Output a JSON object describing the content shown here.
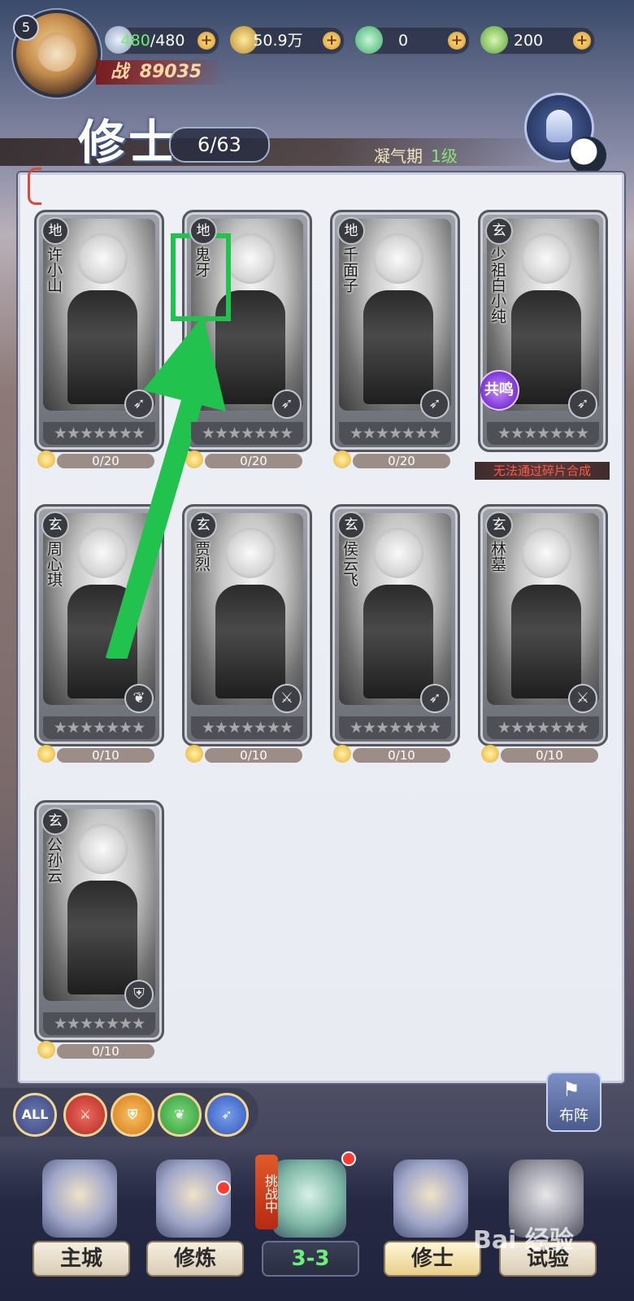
{
  "player": {
    "level": "5",
    "power_label": "战",
    "power_value": "89035"
  },
  "resources": {
    "stamina_current": "480",
    "stamina_sep_max": "/480",
    "coins": "50.9万",
    "jade": "0",
    "leaf": "200"
  },
  "page": {
    "title": "修士",
    "count": "6/63",
    "realm": "凝气期",
    "realm_level": "1级"
  },
  "cards": [
    {
      "grade": "地",
      "name": "许小山",
      "class_icon": "arrow-icon",
      "shards": "0/20"
    },
    {
      "grade": "地",
      "name": "鬼牙",
      "class_icon": "arrow-icon",
      "shards": "0/20"
    },
    {
      "grade": "地",
      "name": "千面子",
      "class_icon": "arrow-icon",
      "shards": "0/20"
    },
    {
      "grade": "玄",
      "name": "少祖白小纯",
      "class_icon": "arrow-icon",
      "resonance": "共鸣",
      "notice": "无法通过碎片合成"
    },
    {
      "grade": "玄",
      "name": "周心琪",
      "class_icon": "leaf-icon",
      "shards": "0/10"
    },
    {
      "grade": "玄",
      "name": "贾烈",
      "class_icon": "sword-icon",
      "shards": "0/10"
    },
    {
      "grade": "玄",
      "name": "侯云飞",
      "class_icon": "arrow-icon",
      "shards": "0/10"
    },
    {
      "grade": "玄",
      "name": "林墓",
      "class_icon": "sword-icon",
      "shards": "0/10"
    },
    {
      "grade": "玄",
      "name": "公孙云",
      "class_icon": "shield-icon",
      "shards": "0/10"
    }
  ],
  "stars_glyph": "★★★★★★★",
  "filters": {
    "all": "ALL",
    "sword": "⚔",
    "shield": "⛨",
    "leaf": "❦",
    "arrow": "➶"
  },
  "formation_label": "布阵",
  "challenge_tag": "挑战中",
  "nav": {
    "city": "主城",
    "train": "修炼",
    "stage": "3-3",
    "cultivator": "修士",
    "trial": "试验"
  },
  "watermark": "Bai 经验",
  "colors": {
    "highlight_green": "#21c24d",
    "stamina_green": "#6ef06b"
  }
}
